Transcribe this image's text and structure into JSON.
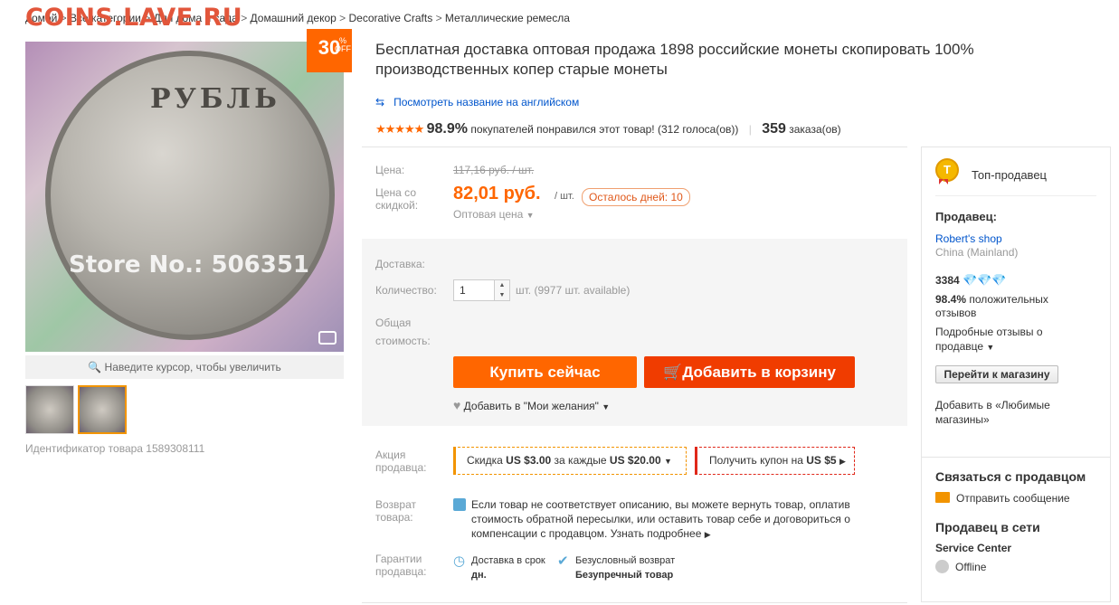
{
  "watermark": "COINS.LAVE.RU",
  "breadcrumb": [
    "домой",
    "Все категории",
    "Для дома и сада",
    "Домашний декор",
    "Decorative Crafts",
    "Металлические ремесла"
  ],
  "image": {
    "discount_number": "30",
    "discount_pct": "%",
    "discount_off": "OFF",
    "coin_text": "РУБЛЬ",
    "store_watermark": "Store No.: 506351",
    "zoom_hint": "Наведите курсор, чтобы увеличить",
    "product_id": "Идентификатор товара 1589308111"
  },
  "product": {
    "title": "Бесплатная доставка оптовая продажа 1898 российские монеты скопировать 100% производственных копер старые монеты",
    "translate_link": "Посмотреть название на английском",
    "stars": "★★★★★",
    "rating_pct": "98.9%",
    "rating_text": "покупателей понравился этот товар! (312 голоса(ов))",
    "orders_count": "359",
    "orders_label": "заказа(ов)"
  },
  "pricing": {
    "price_label": "Цена:",
    "old_price": "117,16 руб. / шт.",
    "discount_label": "Цена со скидкой:",
    "price": "82,01 руб.",
    "per_unit": "/ шт.",
    "days_left": "Осталось дней: 10",
    "wholesale": "Оптовая цена"
  },
  "purchase": {
    "shipping_label": "Доставка:",
    "qty_label": "Количество:",
    "qty_value": "1",
    "available": "шт. (9977 шт. available)",
    "total_label_1": "Общая",
    "total_label_2": "стоимость:",
    "buy_now": "Купить сейчас",
    "add_to_cart": "Добавить в корзину",
    "wishlist": "Добавить в \"Мои желания\""
  },
  "promo": {
    "label_1": "Акция",
    "label_2": "продавца:",
    "coupon_prefix": "Скидка",
    "coupon_amount": "US $3.00",
    "coupon_mid": "за каждые",
    "coupon_threshold": "US $20.00",
    "get_coupon": "Получить купон на",
    "get_coupon_amount": "US $5"
  },
  "returns": {
    "label_1": "Возврат",
    "label_2": "товара:",
    "text": "Если товар не соответствует описанию, вы можете вернуть товар, оплатив стоимость обратной пересылки, или оставить товар себе и договориться о компенсации с продавцом.",
    "more": "Узнать подробнее"
  },
  "guarantee": {
    "label_1": "Гарантии",
    "label_2": "продавца:",
    "item1_line1": "Доставка в срок",
    "item1_line2": "дн.",
    "item2_line1": "Безусловный возврат",
    "item2_line2": "Безупречный товар"
  },
  "seller": {
    "badge": "T",
    "top_seller": "Топ-продавец",
    "heading": "Продавец:",
    "shop_name": "Robert's shop",
    "country": "China (Mainland)",
    "score": "3384",
    "diamonds": "💎💎💎",
    "positive_pct": "98.4%",
    "positive_text_1": "положительных",
    "positive_text_2": "отзывов",
    "detailed_1": "Подробные отзывы о",
    "detailed_2": "продавце",
    "go_store": "Перейти к магазину",
    "favorite_1": "Добавить в «Любимые",
    "favorite_2": "магазины»",
    "contact_heading": "Связаться с продавцом",
    "send_message": "Отправить сообщение",
    "online_heading": "Продавец в сети",
    "service_center": "Service Center",
    "status": "Offline"
  },
  "colors": {
    "accent": "#ff6600",
    "cart": "#f03c00",
    "link": "#0055cc"
  }
}
